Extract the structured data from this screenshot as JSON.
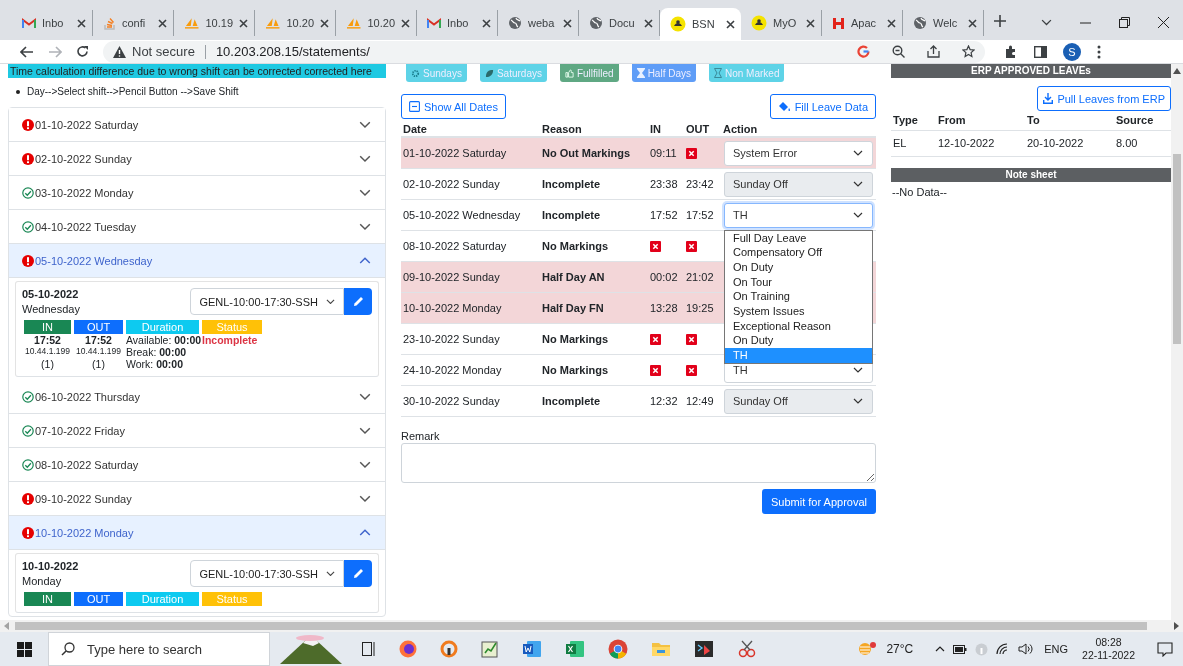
{
  "browser": {
    "tabs": [
      {
        "title": "Inbo",
        "kind": "gmail",
        "selected": false
      },
      {
        "title": "confi",
        "kind": "stack",
        "selected": false
      },
      {
        "title": "10.19",
        "kind": "sail",
        "selected": false
      },
      {
        "title": "10.20",
        "kind": "sail",
        "selected": false
      },
      {
        "title": "10.20",
        "kind": "sail",
        "selected": false
      },
      {
        "title": "Inbo",
        "kind": "gmail",
        "selected": false
      },
      {
        "title": "weba",
        "kind": "globe",
        "selected": false
      },
      {
        "title": "Docu",
        "kind": "globe",
        "selected": false
      },
      {
        "title": "BSN",
        "kind": "round",
        "selected": true
      },
      {
        "title": "MyO",
        "kind": "round",
        "selected": false
      },
      {
        "title": "Apac",
        "kind": "hshape",
        "selected": false
      },
      {
        "title": "Welc",
        "kind": "globe",
        "selected": false
      }
    ],
    "security": "Not secure",
    "url": "10.203.208.15/statements/",
    "profile_initial": "S"
  },
  "left": {
    "notice": "Time calculation difference due to wrong shift can be corrected corrected here",
    "hint": "Day-->Select shift-->Pencil Button -->Save Shift",
    "days": [
      {
        "label": "01-10-2022 Saturday",
        "kind": "error",
        "expanded": false
      },
      {
        "label": "02-10-2022 Sunday",
        "kind": "error",
        "expanded": false
      },
      {
        "label": "03-10-2022 Monday",
        "kind": "ok",
        "expanded": false
      },
      {
        "label": "04-10-2022 Tuesday",
        "kind": "ok",
        "expanded": false
      },
      {
        "label": "05-10-2022 Wednesday",
        "kind": "error",
        "expanded": true,
        "detail": {
          "date": "05-10-2022",
          "weekday": "Wednesday",
          "shift": "GENL-10:00-17:30-SSH",
          "headers": [
            "IN",
            "OUT",
            "Duration",
            "Status"
          ],
          "in": "17:52",
          "out": "17:52",
          "available": "Available: **00:00**",
          "status": "Incomplete",
          "in_ip": "10.44.1.199",
          "out_ip": "10.44.1.199",
          "break": "Break: **00:00**",
          "in_count": "(1)",
          "out_count": "(1)",
          "work": "Work: **00:00**"
        }
      },
      {
        "label": "06-10-2022 Thursday",
        "kind": "ok",
        "expanded": false
      },
      {
        "label": "07-10-2022 Friday",
        "kind": "ok",
        "expanded": false
      },
      {
        "label": "08-10-2022 Saturday",
        "kind": "ok",
        "expanded": false
      },
      {
        "label": "09-10-2022 Sunday",
        "kind": "error",
        "expanded": false
      },
      {
        "label": "10-10-2022 Monday",
        "kind": "error",
        "expanded": true,
        "detail": {
          "date": "10-10-2022",
          "weekday": "Monday",
          "shift": "GENL-10:00-17:30-SSH",
          "headers": [
            "IN",
            "OUT",
            "Duration",
            "Status"
          ]
        }
      }
    ]
  },
  "statement": {
    "legend": [
      {
        "label": "Sundays",
        "kind": "gear",
        "color": "#5ed3e7"
      },
      {
        "label": "Saturdays",
        "kind": "leaf",
        "color": "#5ed3e7"
      },
      {
        "label": "Fullfilled",
        "kind": "thumb",
        "color": "#5fa883"
      },
      {
        "label": "Half Days",
        "kind": "hourglass",
        "color": "#5f9df7"
      },
      {
        "label": "Non Marked",
        "kind": "hourglass-outline",
        "color": "#5ed3e7"
      }
    ],
    "show_all": "Show All Dates",
    "fill_leave": "Fill Leave Data",
    "columns": [
      "Date",
      "Reason",
      "IN",
      "OUT",
      "Action"
    ],
    "rows": [
      {
        "date": "01-10-2022 Saturday",
        "reason": "No Out Markings",
        "in": "09:11",
        "in_missing": false,
        "out_missing": true,
        "highlighted": true,
        "action": {
          "value": "System Error",
          "disabled": false,
          "open": false
        }
      },
      {
        "date": "02-10-2022 Sunday",
        "reason": "Incomplete",
        "in": "23:38",
        "out": "23:42",
        "in_missing": false,
        "out_missing": false,
        "highlighted": false,
        "action": {
          "value": "Sunday Off",
          "disabled": true,
          "open": false
        }
      },
      {
        "date": "05-10-2022 Wednesday",
        "reason": "Incomplete",
        "in": "17:52",
        "out": "17:52",
        "in_missing": false,
        "out_missing": false,
        "highlighted": false,
        "action": {
          "value": "TH",
          "disabled": false,
          "open": true,
          "options": [
            {
              "label": "Full Day Leave",
              "selected": false
            },
            {
              "label": "Compensatory Off",
              "selected": false
            },
            {
              "label": "On Duty",
              "selected": false
            },
            {
              "label": "On Tour",
              "selected": false
            },
            {
              "label": "On Training",
              "selected": false
            },
            {
              "label": "System Issues",
              "selected": false
            },
            {
              "label": "Exceptional Reason",
              "selected": false
            },
            {
              "label": "On Duty",
              "selected": false
            },
            {
              "label": "TH",
              "selected": true
            }
          ]
        }
      },
      {
        "date": "08-10-2022 Saturday",
        "reason": "No Markings",
        "in_missing": true,
        "out_missing": true,
        "highlighted": false
      },
      {
        "date": "09-10-2022 Sunday",
        "reason": "Half Day AN",
        "in": "00:02",
        "out": "21:02",
        "in_missing": false,
        "out_missing": false,
        "highlighted": true
      },
      {
        "date": "10-10-2022 Monday",
        "reason": "Half Day FN",
        "in": "13:28",
        "out": "19:25",
        "in_missing": false,
        "out_missing": false,
        "highlighted": true
      },
      {
        "date": "23-10-2022 Sunday",
        "reason": "No Markings",
        "in_missing": true,
        "out_missing": true,
        "highlighted": false
      },
      {
        "date": "24-10-2022 Monday",
        "reason": "No Markings",
        "in_missing": true,
        "out_missing": true,
        "highlighted": false,
        "action": {
          "value": "TH",
          "disabled": false,
          "open": false
        }
      },
      {
        "date": "30-10-2022 Sunday",
        "reason": "Incomplete",
        "in": "12:32",
        "out": "12:49",
        "in_missing": false,
        "out_missing": false,
        "highlighted": false,
        "action": {
          "value": "Sunday Off",
          "disabled": true,
          "open": false
        }
      }
    ],
    "remark_label": "Remark",
    "submit": "Submit for Approval"
  },
  "erp": {
    "title": "ERP APPROVED LEAVEs",
    "pull": "Pull Leaves from ERP",
    "columns": [
      "Type",
      "From",
      "To",
      "Source"
    ],
    "rows": [
      [
        "EL",
        "12-10-2022",
        "20-10-2022",
        "8.00"
      ]
    ],
    "note_title": "Note sheet",
    "note_empty": "--No Data--"
  },
  "taskbar": {
    "search_placeholder": "Type here to search",
    "temperature": "27°C",
    "language": "ENG",
    "time": "08:28",
    "date": "22-11-2022"
  }
}
